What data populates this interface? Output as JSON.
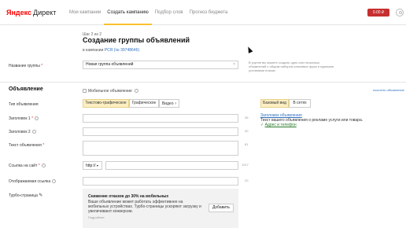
{
  "header": {
    "logo_ya": "Яндекс",
    "logo_direct": "Директ",
    "menu": [
      "Мои кампании",
      "Создать кампанию",
      "Подбор слов",
      "Прогноз бюджета"
    ],
    "balance": "0.00 ₽"
  },
  "page": {
    "step": "Шаг 2 из 2",
    "title": "Создание группы объявлений",
    "campaign_prefix": "в кампании",
    "campaign_link": "РСЯ (№ 39748646)"
  },
  "group_name": {
    "label": "Название группы",
    "value": "Новая группа объявлений",
    "counter": "",
    "note": "В группе вы можете создать одно или несколько объявлений с общим набором ключевых фраз и едиными условиями показа"
  },
  "ad": {
    "section_title": "Объявление",
    "mobile_label": "Мобильное объявление",
    "clear_link": "очистить объявление",
    "type_label": "Тип объявления",
    "types": [
      "Текстово-графическое",
      "Графическое",
      "Видео"
    ],
    "headline1_label": "Заголовок 1",
    "headline1_counter": "35",
    "headline2_label": "Заголовок 2",
    "headline2_counter": "30",
    "text_label": "Текст объявления",
    "text_counter": "81",
    "url_label": "Ссылка на сайт",
    "url_protocol": "http://",
    "url_counter": "1017",
    "display_url_label": "Отображаемая ссылка",
    "display_url_counter": "20",
    "turbo_label": "Турбо-страница"
  },
  "preview": {
    "tabs": [
      "Базовый вид",
      "В сетях"
    ],
    "title": "Заголовок объявления",
    "text": "Текст вашего объявления о рекламе услуги или товара.",
    "link": "Адрес и телефон"
  },
  "turbo": {
    "title": "Снижение отказов до 30% на мобильных",
    "body": "Ваше объявление может работать эффективнее на мобильных устройствах. Турбо-страницы ускоряют загрузку и увеличивают конверсии.",
    "more": "Подробнее",
    "button": "Добавить"
  }
}
